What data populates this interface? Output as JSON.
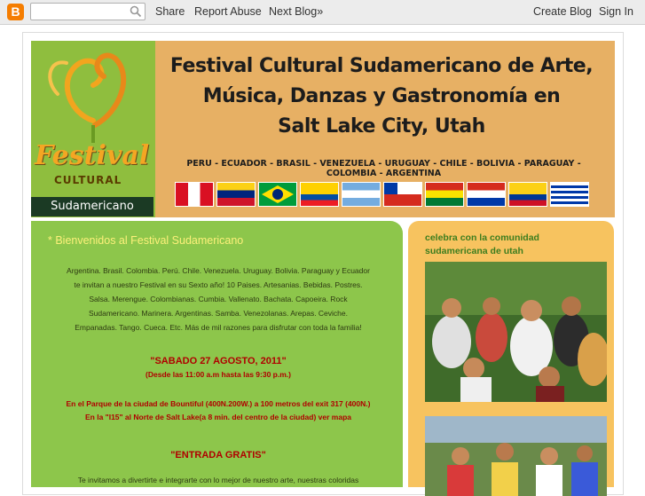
{
  "navbar": {
    "logo_letter": "B",
    "search_value": "",
    "links": [
      "Share",
      "Report Abuse",
      "Next Blog»"
    ],
    "right_links": [
      "Create Blog",
      "Sign In"
    ]
  },
  "banner": {
    "title_lines": [
      "Festival Cultural Sudamericano de Arte,",
      "Música, Danzas y Gastronomía en",
      "Salt Lake City, Utah"
    ],
    "countries": "PERU - ECUADOR - BRASIL - VENEZUELA - URUGUAY - CHILE - BOLIVIA - PARAGUAY - COLOMBIA - ARGENTINA",
    "logo_festival": "Festival",
    "logo_cultural": "CULTURAL",
    "logo_sudamericano": "Sudamericano",
    "flag_names": [
      "peru-flag",
      "venezuela-flag",
      "brasil-flag",
      "ecuador-flag",
      "argentina-flag",
      "chile-flag",
      "bolivia-flag",
      "paraguay-flag",
      "colombia-flag",
      "uruguay-flag"
    ]
  },
  "post": {
    "title": "* Bienvenidos al Festival Sudamericano",
    "body_lines": [
      "Argentina. Brasil. Colombia. Perú. Chile. Venezuela. Uruguay. Bolivia. Paraguay y Ecuador",
      "te invitan a nuestro Festival en su Sexto año! 10 Paises. Artesanias. Bebidas. Postres.",
      "Salsa. Merengue. Colombianas. Cumbia. Vallenato. Bachata. Capoeira. Rock",
      "Sudamericano. Marinera. Argentinas. Samba. Venezolanas. Arepas. Ceviche.",
      "Empanadas. Tango. Cueca. Etc. Más de mil razones para disfrutar con toda la familia!"
    ],
    "date": "\"SABADO 27 AGOSTO, 2011\"",
    "hours": "(Desde las 11:00 a.m hasta las 9:30 p.m.)",
    "place_lines": [
      "En el Parque de la ciudad de Bountiful (400N.200W.) a 100 metros del exit 317 (400N.)",
      "En la \"I15\" al Norte de Salt Lake(a 8 min. del centro de la ciudad) ver mapa"
    ],
    "free": "\"ENTRADA GRATIS\"",
    "invite": "Te invitamos a divertirte e integrarte con lo mejor de nuestro arte, nuestras coloridas"
  },
  "sidebar": {
    "title": "celebra con la comunidad sudamericana de utah"
  },
  "colors": {
    "banner_bg": "#e7b064",
    "main_bg": "#8dc64b",
    "sidebar_bg": "#f7c35f",
    "post_title": "#fdf07a",
    "highlight_red": "#b00000"
  }
}
